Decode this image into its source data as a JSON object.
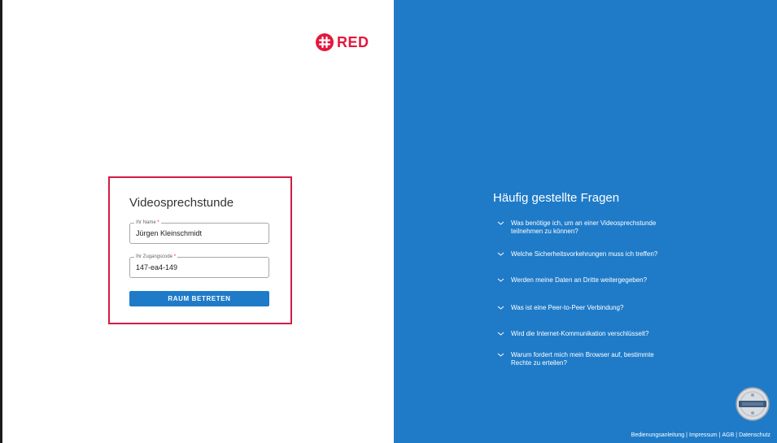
{
  "brand": {
    "logo_text": "RED",
    "logo_color": "#e4173e"
  },
  "login": {
    "title": "Videosprechstunde",
    "name_label": "Ihr Name",
    "name_value": "Jürgen Kleinschmidt",
    "code_label": "Ihr Zugangscode",
    "code_value": "147-ea4-149",
    "required_mark": "*",
    "submit_label": "RAUM BETRETEN"
  },
  "faq": {
    "title": "Häufig gestellte Fragen",
    "items": [
      {
        "line1": "Was benötige ich, um an einer Videosprechstunde",
        "line2": "teilnehmen zu können?"
      },
      {
        "line1": "Welche Sicherheitsvorkehrungen muss ich treffen?",
        "line2": ""
      },
      {
        "line1": "Werden meine Daten an Dritte weitergegeben?",
        "line2": ""
      },
      {
        "line1": "Was ist eine Peer-to-Peer Verbindung?",
        "line2": ""
      },
      {
        "line1": "Wird die Internet-Kommunikation verschlüsselt?",
        "line2": ""
      },
      {
        "line1": "Warum fordert mich mein Browser auf, bestimmte",
        "line2": "Rechte zu erteilen?"
      }
    ]
  },
  "footer": {
    "links": [
      "Bedienungsanleitung",
      "Impressum",
      "AGB",
      "Datenschutz"
    ],
    "separator": "|"
  },
  "colors": {
    "accent_blue": "#1f7bc8",
    "highlight_red": "#d21c47"
  }
}
